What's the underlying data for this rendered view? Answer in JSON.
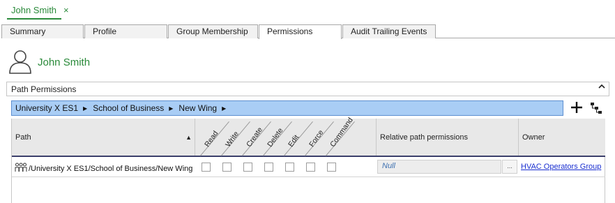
{
  "doc_tab": {
    "title": "John Smith",
    "close_glyph": "×"
  },
  "tabs": [
    "Summary",
    "Profile",
    "Group Membership",
    "Permissions",
    "Audit Trailing Events"
  ],
  "active_tab": "Permissions",
  "user": {
    "name": "John Smith",
    "icon": "user-icon"
  },
  "section": {
    "title": "Path Permissions",
    "collapse_icon": "chevron-up-icon"
  },
  "breadcrumb": [
    "University X ES1",
    "School of Business",
    "New Wing"
  ],
  "toolbar": {
    "add_icon": "plus-icon",
    "tree_icon": "hierarchy-icon"
  },
  "table": {
    "columns": {
      "path": "Path",
      "permissions": [
        "Read",
        "Write",
        "Create",
        "Delete",
        "Edit",
        "Force",
        "Command"
      ],
      "relative": "Relative path permissions",
      "owner": "Owner"
    },
    "rows": [
      {
        "icon": "group-icon",
        "path": "/University X ES1/School of Business/New Wing",
        "permissions": [
          false,
          false,
          false,
          false,
          false,
          false,
          false
        ],
        "relative_value": "Null",
        "browse_label": "...",
        "owner": "HVAC Operators Group"
      }
    ]
  },
  "colors": {
    "accent_green": "#2a8a3a",
    "breadcrumb_bg": "#a9cdf5",
    "link_blue": "#1a2fd0"
  }
}
